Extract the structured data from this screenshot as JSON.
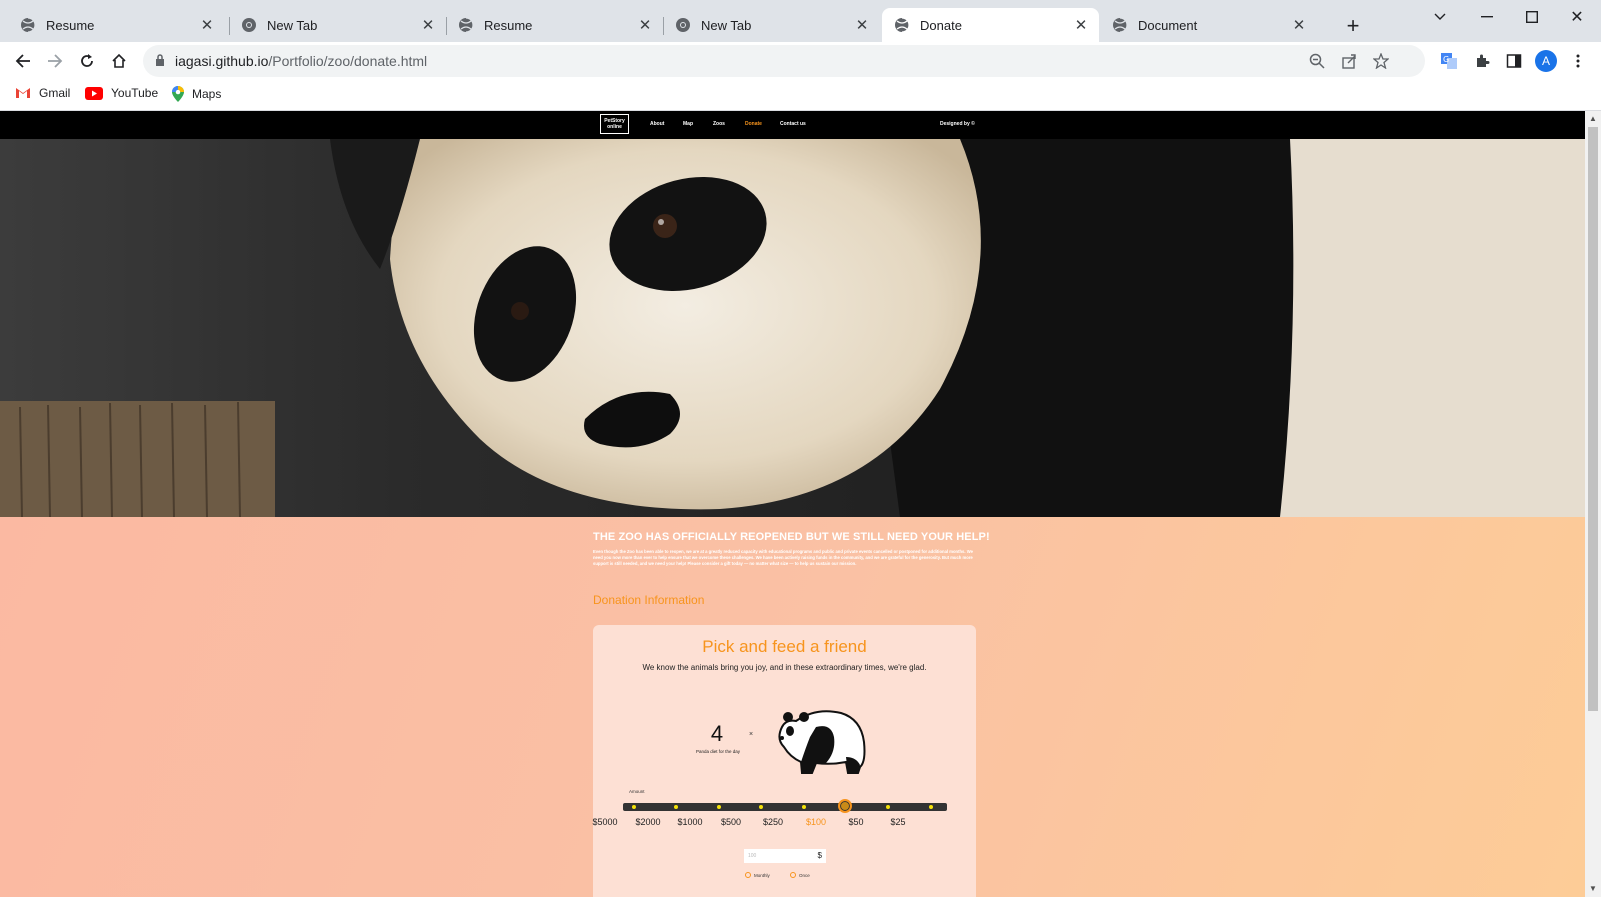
{
  "browser": {
    "tabs": [
      {
        "title": "Resume",
        "active": false,
        "icon": "globe-icon"
      },
      {
        "title": "New Tab",
        "active": false,
        "icon": "chrome-icon"
      },
      {
        "title": "Resume",
        "active": false,
        "icon": "globe-icon"
      },
      {
        "title": "New Tab",
        "active": false,
        "icon": "chrome-icon"
      },
      {
        "title": "Donate",
        "active": true,
        "icon": "globe-icon"
      },
      {
        "title": "Document",
        "active": false,
        "icon": "globe-icon"
      }
    ],
    "url_host": "iagasi.github.io",
    "url_path": "/Portfolio/zoo/donate.html",
    "avatar_letter": "A",
    "bookmarks": [
      {
        "label": "Gmail",
        "icon": "gmail-icon"
      },
      {
        "label": "YouTube",
        "icon": "youtube-icon"
      },
      {
        "label": "Maps",
        "icon": "maps-icon"
      }
    ]
  },
  "site": {
    "logo_line1": "PetStory",
    "logo_line2": "online",
    "nav": [
      {
        "label": "About",
        "active": false
      },
      {
        "label": "Map",
        "active": false
      },
      {
        "label": "Zoos",
        "active": false
      },
      {
        "label": "Donate",
        "active": true
      },
      {
        "label": "Contact us",
        "active": false
      }
    ],
    "designed_by": "Designed by ©",
    "accent_color": "#f7941d"
  },
  "main": {
    "headline": "THE ZOO HAS OFFICIALLY REOPENED BUT WE STILL NEED YOUR HELP!",
    "body": "Even though the Zoo has been able to reopen, we are at a greatly reduced capacity with educational programs and public and private events cancelled or postponed for additional months. We need you now more than ever to help ensure that we overcome these challenges. We have been actively raising funds in the community, and we are grateful for the generosity. But much more support is still needed, and we need your help! Please consider a gift today — no matter what size — to help us sustain our mission.",
    "donation_info": "Donation Information"
  },
  "card": {
    "title": "Pick and feed a friend",
    "subtitle": "We know the animals bring you joy, and in these extraordinary times, we're glad.",
    "count": "4",
    "times": "×",
    "count_label": "Panda diet for the day",
    "amount_label": "Amount",
    "amounts": [
      "$5000",
      "$2000",
      "$1000",
      "$500",
      "$250",
      "$100",
      "$50",
      "$25"
    ],
    "selected_amount": "$100",
    "input_placeholder": "100",
    "currency": "$",
    "frequency_options": [
      "Monthly",
      "Once"
    ]
  }
}
